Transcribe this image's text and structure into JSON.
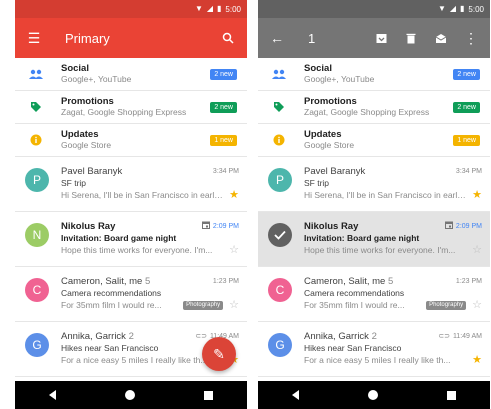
{
  "colors": {
    "primary_red": "#ea4335",
    "status_red": "#d43d31",
    "grey_bar": "#757575",
    "star_yellow": "#f5b400",
    "blue": "#4285f4"
  },
  "status_bar": {
    "time": "5:00"
  },
  "left": {
    "title": "Primary",
    "menu_icon": "hamburger-menu-icon",
    "search_icon": "search-icon",
    "categories": [
      {
        "name": "Social",
        "sub": "Google+, YouTube",
        "badge": "2 new",
        "badge_color": "#4285f4",
        "icon": "people-icon",
        "icon_color": "#4285f4"
      },
      {
        "name": "Promotions",
        "sub": "Zagat, Google Shopping Express",
        "badge": "2 new",
        "badge_color": "#0f9d58",
        "icon": "tag-icon",
        "icon_color": "#0f9d58"
      },
      {
        "name": "Updates",
        "sub": "Google Store",
        "badge": "1 new",
        "badge_color": "#f4b400",
        "icon": "info-icon",
        "icon_color": "#f4b400"
      }
    ],
    "mails": [
      {
        "initial": "P",
        "avatar_color": "#4db6ac",
        "sender": "Pavel Baranyk",
        "time": "3:34 PM",
        "subject": "SF trip",
        "snippet": "Hi Serena, I'll be in San Francisco in early ...",
        "starred": true,
        "unread": false
      },
      {
        "initial": "N",
        "avatar_color": "#9ccc65",
        "sender": "Nikolus Ray",
        "time": "2:09 PM",
        "subject": "Invitation: Board game night",
        "snippet": "Hope this time works for everyone. I'm...",
        "starred": false,
        "unread": true,
        "has_calendar": true
      },
      {
        "initial": "C",
        "avatar_color": "#f06292",
        "sender": "Cameron, Salit, me",
        "sender_count": "5",
        "time": "1:23 PM",
        "subject": "Camera recommendations",
        "snippet": "For 35mm film I would re...",
        "chip": "Photography",
        "starred": false,
        "unread": false
      },
      {
        "initial": "G",
        "avatar_color": "#5c8fe8",
        "sender": "Annika, Garrick",
        "sender_count": "2",
        "time": "11:49 AM",
        "subject": "Hikes near San Francisco",
        "snippet": "For a nice easy 5 miles I really like th...",
        "starred": true,
        "unread": false,
        "has_attach": true
      }
    ],
    "fab_icon": "pencil-icon"
  },
  "right": {
    "selection_count": "1",
    "back_icon": "arrow-back-icon",
    "action_icons": [
      "archive-icon",
      "delete-icon",
      "mark-unread-icon",
      "more-vert-icon"
    ]
  }
}
